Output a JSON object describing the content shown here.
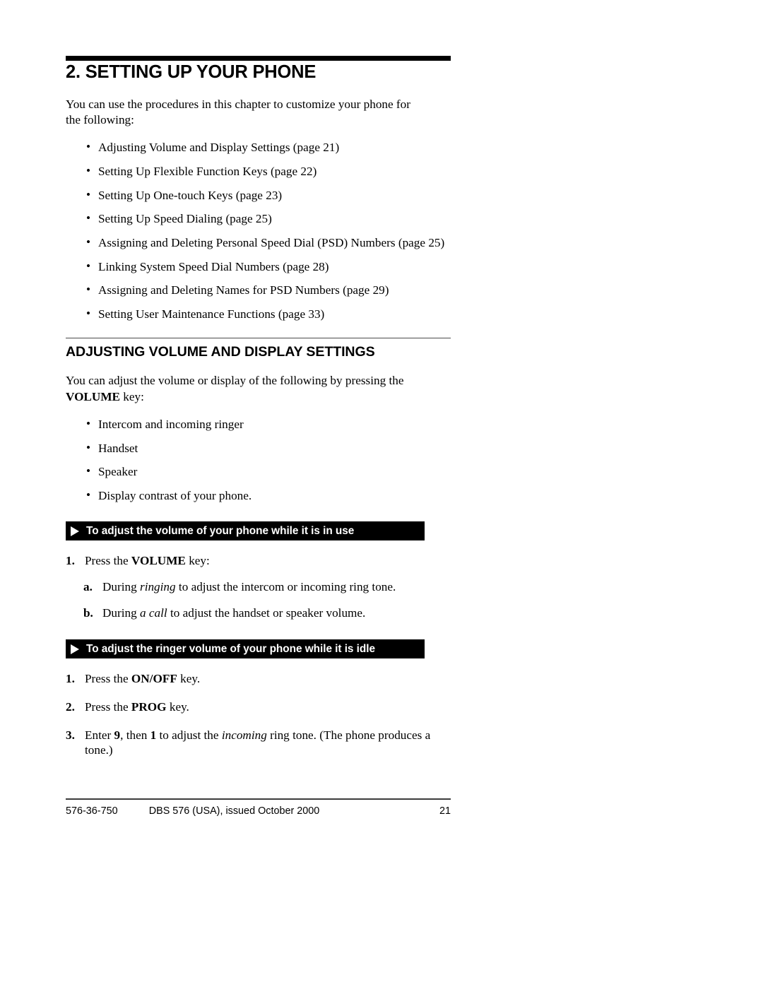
{
  "chapter": {
    "title": "2. SETTING UP YOUR PHONE",
    "intro": "You can use the procedures in this chapter to customize your phone for the following:",
    "topics": [
      "Adjusting Volume and Display Settings (page 21)",
      "Setting Up Flexible Function Keys (page 22)",
      "Setting Up One-touch Keys (page 23)",
      "Setting Up Speed Dialing (page 25)",
      "Assigning and Deleting Personal Speed Dial (PSD) Numbers  (page 25)",
      "Linking System Speed Dial Numbers (page 28)",
      "Assigning and Deleting Names for PSD Numbers (page 29)",
      "Setting User Maintenance Functions (page 33)"
    ]
  },
  "section": {
    "title": "ADJUSTING VOLUME AND DISPLAY SETTINGS",
    "intro_pre": "You can adjust the volume or display of the following by pressing the ",
    "intro_key": "VOLUME",
    "intro_post": " key:",
    "items": [
      "Intercom and incoming ringer",
      "Handset",
      "Speaker",
      "Display contrast of your phone."
    ]
  },
  "procedure_1": {
    "heading": "To adjust the volume of your phone while it is in use",
    "marker": "right-triangle-marker",
    "steps": [
      {
        "num": "1.",
        "pre": "Press the ",
        "key": "VOLUME",
        "post": " key:"
      }
    ],
    "substeps": [
      {
        "num": "a.",
        "pre": "During ",
        "em": "ringing",
        "post": " to adjust the intercom or incoming ring tone."
      },
      {
        "num": "b.",
        "pre": "During ",
        "em": "a call",
        "post": " to adjust the handset or speaker volume."
      }
    ]
  },
  "procedure_2": {
    "heading": "To adjust the ringer volume of your phone while it is idle",
    "marker": "right-triangle-marker",
    "steps": [
      {
        "num": "1.",
        "pre": "Press the ",
        "key": "ON/OFF",
        "post": " key."
      },
      {
        "num": "2.",
        "pre": "Press the ",
        "key": "PROG",
        "post": " key."
      }
    ],
    "step3": {
      "num": "3.",
      "t1": "Enter ",
      "b1": "9",
      "t2": ", then ",
      "b2": "1",
      "t3": " to adjust the ",
      "em": "incoming",
      "t4": " ring tone. (The phone produces a tone.)"
    }
  },
  "footer": {
    "doc_number": "576-36-750",
    "center": "DBS 576 (USA), issued October 2000",
    "page_number": "21"
  }
}
